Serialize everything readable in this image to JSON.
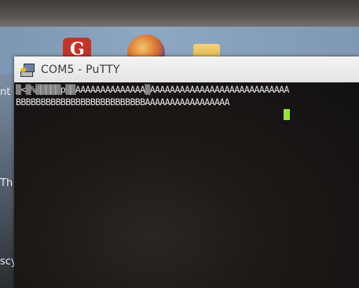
{
  "window": {
    "title": "COM5 - PuTTY",
    "icon": "putty-icon"
  },
  "desktop": {
    "icons": [
      "app-icon-red",
      "app-icon-ball",
      "folder-icon"
    ],
    "left_edge_text": [
      "nt",
      "Th",
      "scy"
    ]
  },
  "terminal": {
    "line1": "▒<▒%▒▒▒▒▒p▒▒AAAAAAAAAAAAAA▒AAAAAAAAAAAAAAAAAAAAAAAAAAAA",
    "line2": "BBBBBBBBBBBBBBBBBBBBBBBBBBAAAAAAAAAAAAAAAAA",
    "cursor_color": "#9be33a"
  }
}
